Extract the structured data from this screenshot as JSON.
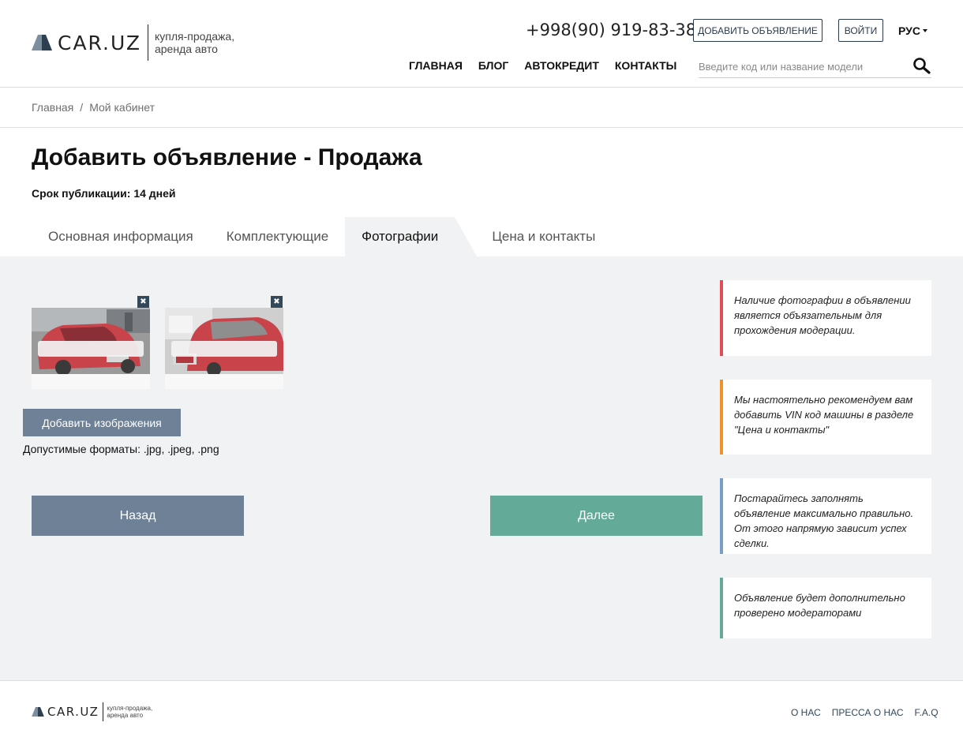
{
  "header": {
    "logo_text": "CAR.UZ",
    "tagline_line1": "купля-продажа,",
    "tagline_line2": "аренда авто",
    "phone": "+998(90) 919-83-38",
    "add_listing_label": "ДОБАВИТЬ ОБЪЯВЛЕНИЕ",
    "login_label": "ВОЙТИ",
    "language": "РУС",
    "nav": [
      "ГЛАВНАЯ",
      "БЛОГ",
      "АВТОКРЕДИТ",
      "КОНТАКТЫ"
    ],
    "search": {
      "placeholder": "Введите код или название модели",
      "value": "",
      "icon": "search-icon"
    }
  },
  "breadcrumb": {
    "home": "Главная",
    "separator": "/",
    "current": "Мой кабинет"
  },
  "page": {
    "title": "Добавить объявление - Продажа",
    "publication_term": "Срок публикации: 14 дней"
  },
  "tabs": [
    {
      "label": "Основная информация",
      "active": false
    },
    {
      "label": "Комплектующие",
      "active": false
    },
    {
      "label": "Фотографии",
      "active": true
    },
    {
      "label": "Цена и контакты",
      "active": false
    }
  ],
  "photos": {
    "items": [
      {
        "close": "✖",
        "caption": ""
      },
      {
        "close": "✖",
        "caption": ""
      }
    ],
    "add_button_label": "Добавить изображения",
    "formats_text": "Допустимые форматы: .jpg, .jpeg, .png"
  },
  "actions": {
    "back_label": "Назад",
    "next_label": "Далее"
  },
  "notes": [
    {
      "text": "Наличие фотографии в объявлении является объязательным для прохождения модерации.",
      "color": "#e44b55"
    },
    {
      "text": "Мы настоятельно рекомендуем вам добавить VIN код машины в разделе \"Цена и контакты\"",
      "color": "#f0922b"
    },
    {
      "text": "Постарайтесь заполнять объявление максимально правильно. От этого напрямую зависит успех сделки.",
      "color": "#7a9cc8"
    },
    {
      "text": "Объявление будет дополнительно проверено модераторами",
      "color": "#63ab98"
    }
  ],
  "footer": {
    "logo_text": "CAR.UZ",
    "tagline_line1": "купля-продажа,",
    "tagline_line2": "аренда авто",
    "links": [
      "О НАС",
      "ПРЕССА О НАС",
      "F.A.Q"
    ]
  },
  "colors": {
    "primary_button": "#6e8197",
    "accent_green": "#63ab98",
    "panel_bg": "#f1f2f4",
    "dark_blue": "#33485a"
  }
}
